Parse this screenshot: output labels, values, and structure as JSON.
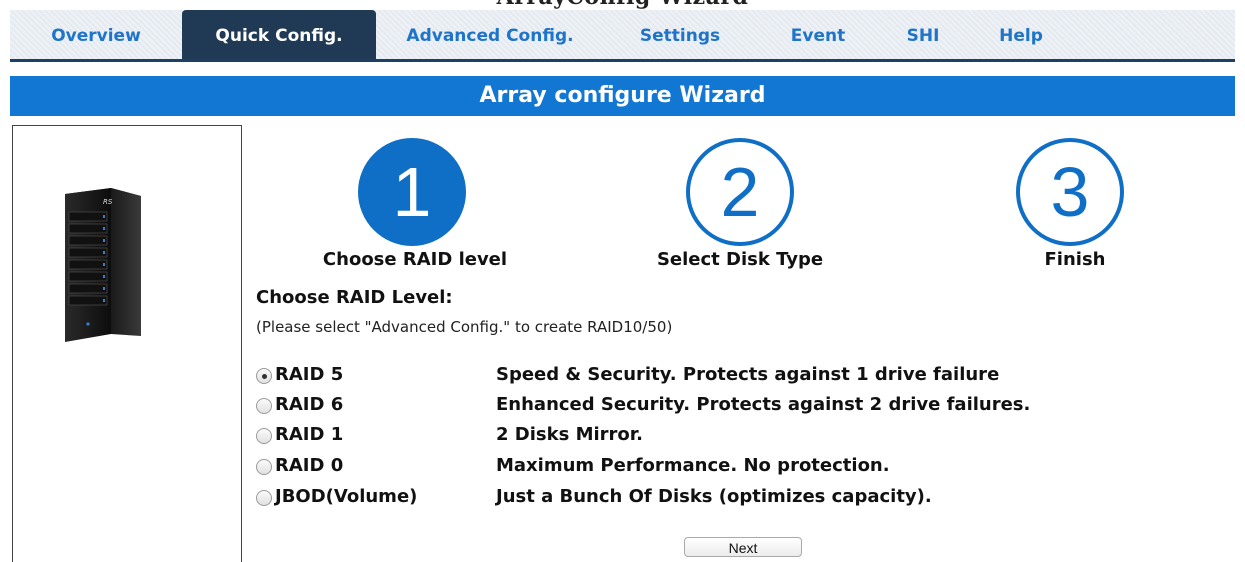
{
  "page": {
    "clipped_heading": "ArrayConfig Wizard"
  },
  "nav": {
    "tabs": [
      {
        "label": "Overview",
        "active": false
      },
      {
        "label": "Quick Config.",
        "active": true
      },
      {
        "label": "Advanced Config.",
        "active": false
      },
      {
        "label": "Settings",
        "active": false
      },
      {
        "label": "Event",
        "active": false
      },
      {
        "label": "SHI",
        "active": false
      },
      {
        "label": "Help",
        "active": false
      }
    ]
  },
  "banner": {
    "title": "Array configure Wizard"
  },
  "steps": [
    {
      "number": "1",
      "label": "Choose RAID level",
      "active": true
    },
    {
      "number": "2",
      "label": "Select Disk Type",
      "active": false
    },
    {
      "number": "3",
      "label": "Finish",
      "active": false
    }
  ],
  "raid_section": {
    "title": "Choose RAID Level:",
    "note": "(Please select \"Advanced Config.\" to create RAID10/50)",
    "options": [
      {
        "name": "RAID 5",
        "description": "Speed & Security. Protects against 1 drive failure",
        "selected": true
      },
      {
        "name": "RAID 6",
        "description": "Enhanced Security. Protects against 2 drive failures.",
        "selected": false
      },
      {
        "name": "RAID 1",
        "description": "2 Disks Mirror.",
        "selected": false
      },
      {
        "name": "RAID 0",
        "description": "Maximum Performance. No protection.",
        "selected": false
      },
      {
        "name": "JBOD(Volume)",
        "description": "Just a Bunch Of Disks (optimizes capacity).",
        "selected": false
      }
    ]
  },
  "next_button": {
    "label": "Next"
  },
  "device_image": {
    "brand_text": "RS"
  },
  "colors": {
    "accent": "#1277d2",
    "nav_active": "#203a55",
    "tab_text": "#1e74c9"
  }
}
